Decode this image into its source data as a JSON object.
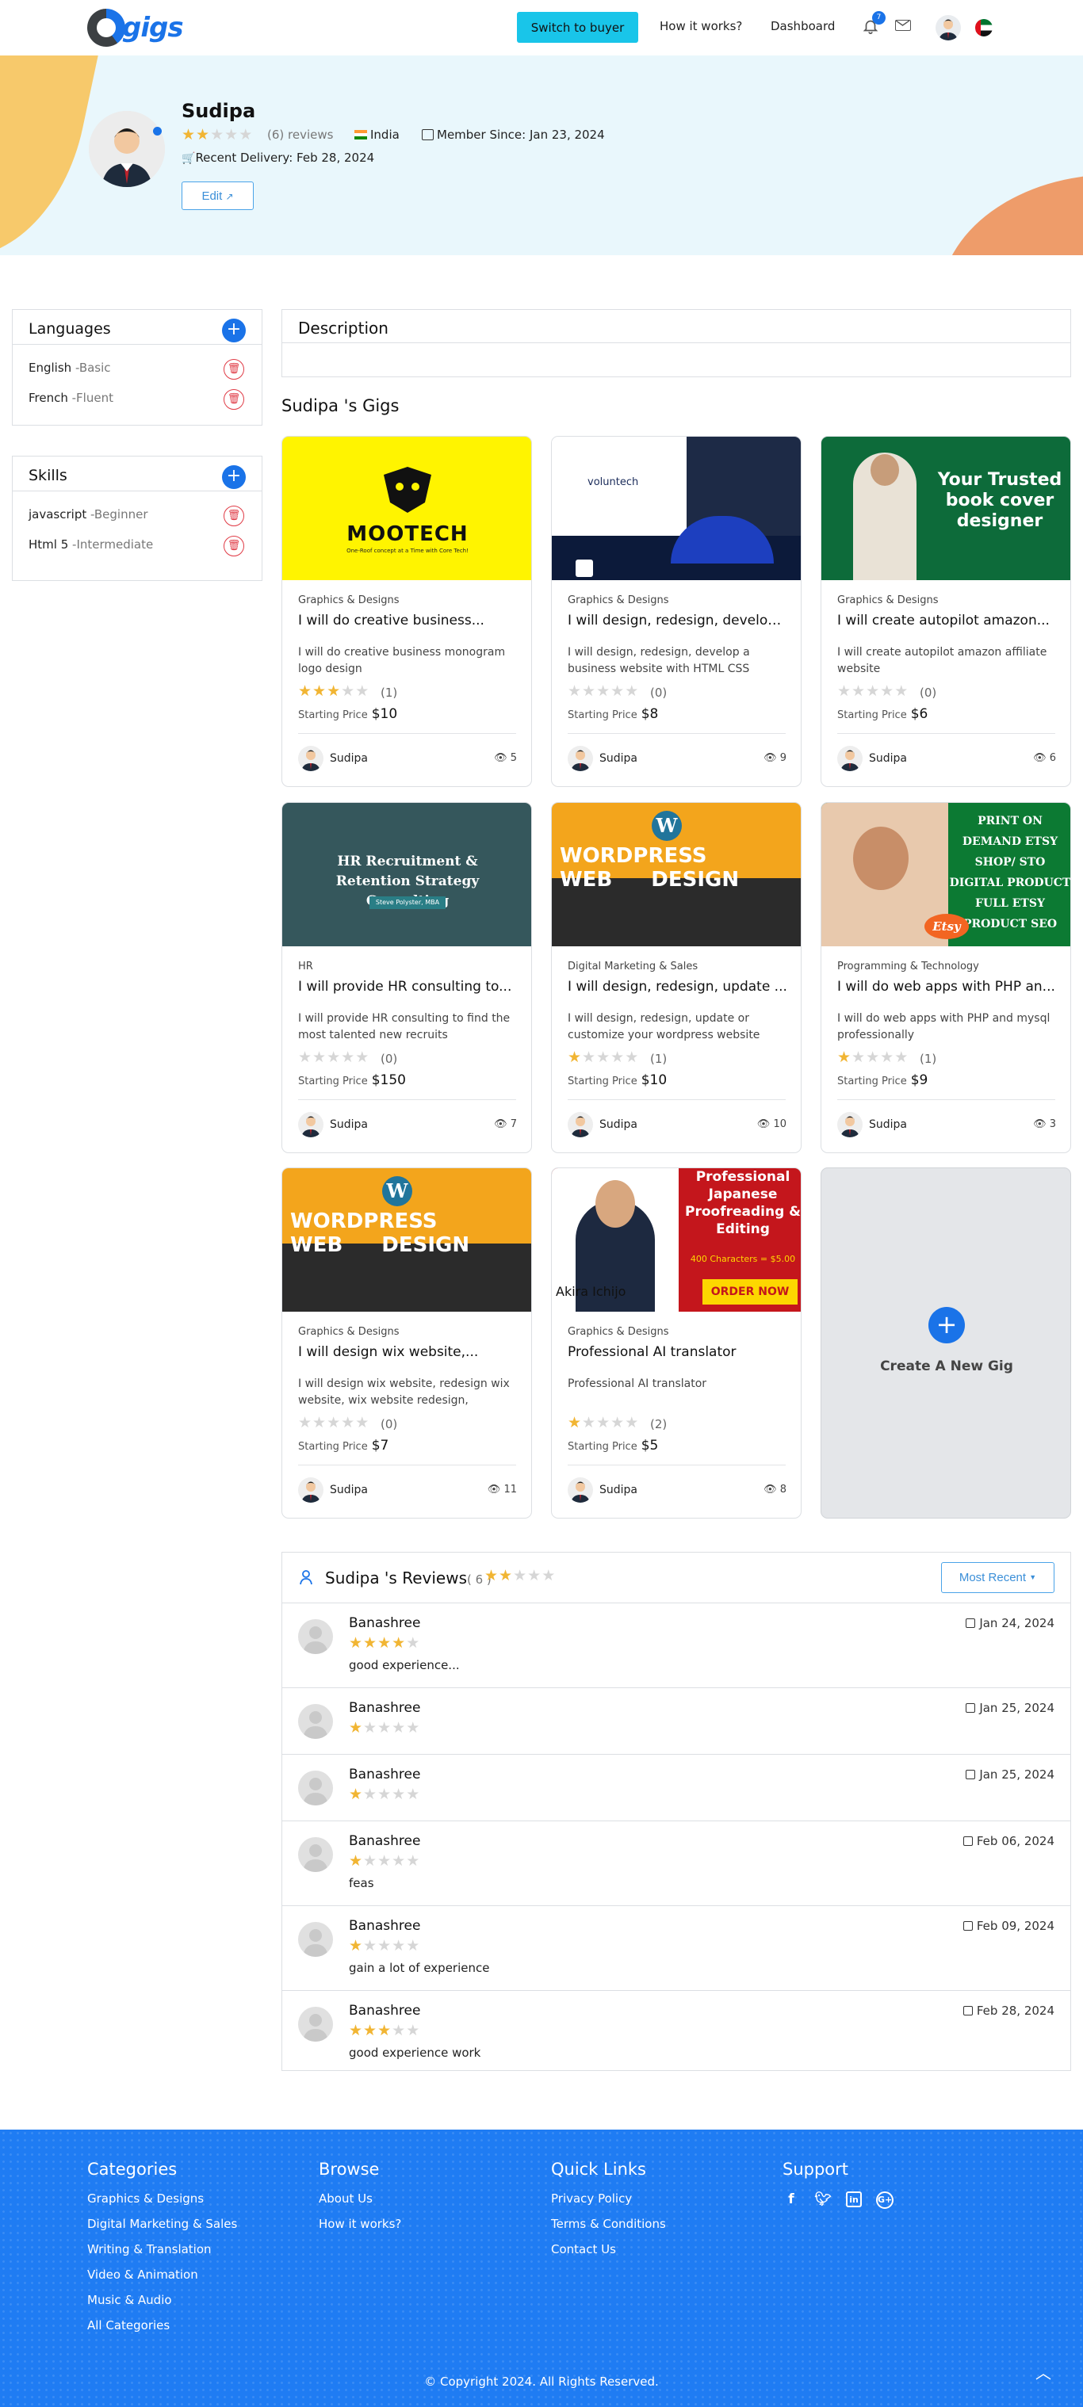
{
  "nav": {
    "logo_text": "gigs",
    "switch_button": "Switch to buyer",
    "how_it_works": "How it works?",
    "dashboard": "Dashboard",
    "notification_count": "7"
  },
  "profile": {
    "name": "Sudipa",
    "rating": 2,
    "reviews_text": "(6) reviews",
    "country": "India",
    "member_since": "Member Since: Jan 23, 2024",
    "recent_delivery": "Recent Delivery: Feb 28, 2024",
    "edit_button": "Edit"
  },
  "languages": {
    "title": "Languages",
    "items": [
      {
        "name": "English",
        "level": " -Basic"
      },
      {
        "name": "French",
        "level": " -Fluent"
      }
    ]
  },
  "skills": {
    "title": "Skills",
    "items": [
      {
        "name": "javascript",
        "level": " -Beginner"
      },
      {
        "name": "Html 5",
        "level": " -Intermediate"
      }
    ]
  },
  "description": {
    "title": "Description"
  },
  "gigs_title": "Sudipa 's Gigs",
  "gigs": [
    {
      "category": "Graphics & Designs",
      "title": "I will do creative business...",
      "desc": "I will do creative business monogram logo design",
      "rating": 3,
      "count": "(1)",
      "price_label": "Starting Price",
      "price": "$10",
      "seller": "Sudipa",
      "views": "5",
      "image_text": "MOOTECH",
      "image_sub": "One-Roof concept at a Time with Core Tech!"
    },
    {
      "category": "Graphics & Designs",
      "title": "I will design, redesign, develop ...",
      "desc": "I will design, redesign, develop a business website with HTML CSS",
      "rating": 0,
      "count": "(0)",
      "price_label": "Starting Price",
      "price": "$8",
      "seller": "Sudipa",
      "views": "9",
      "image_text": "voluntech"
    },
    {
      "category": "Graphics & Designs",
      "title": "I will create autopilot amazon...",
      "desc": "I will create autopilot amazon affiliate website",
      "rating": 0,
      "count": "(0)",
      "price_label": "Starting Price",
      "price": "$6",
      "seller": "Sudipa",
      "views": "6",
      "image_text": "Your Trusted book cover designer"
    },
    {
      "category": "HR",
      "title": "I will provide HR consulting to...",
      "desc": "I will provide HR consulting to find the most talented new recruits",
      "rating": 0,
      "count": "(0)",
      "price_label": "Starting Price",
      "price": "$150",
      "seller": "Sudipa",
      "views": "7",
      "image_text": "HR Recruitment & Retention Strategy Consulting",
      "image_sub": "Steve Polyster, MBA"
    },
    {
      "category": "Digital Marketing & Sales",
      "title": "I will design, redesign, update ...",
      "desc": "I will design, redesign, update or customize your wordpress website",
      "rating": 1,
      "count": "(1)",
      "price_label": "Starting Price",
      "price": "$10",
      "seller": "Sudipa",
      "views": "10",
      "image_text": "WORDPRESS WEB DESIGN"
    },
    {
      "category": "Programming & Technology",
      "title": "I will do web apps with PHP an...",
      "desc": "I will do web apps with PHP and mysql professionally",
      "rating": 1,
      "count": "(1)",
      "price_label": "Starting Price",
      "price": "$9",
      "seller": "Sudipa",
      "views": "3",
      "image_text": "PRINT ON DEMAND ETSY SHOP/ STO DIGITAL PRODUCT FULL ETSY PRODUCT SEO",
      "image_sub": "Etsy"
    },
    {
      "category": "Graphics & Designs",
      "title": "I will design wix website,...",
      "desc": "I will design wix website, redesign wix website, wix website redesign,",
      "rating": 0,
      "count": "(0)",
      "price_label": "Starting Price",
      "price": "$7",
      "seller": "Sudipa",
      "views": "11",
      "image_text": "WORDPRESS WEB DESIGN"
    },
    {
      "category": "Graphics & Designs",
      "title": "Professional AI translator",
      "desc": "Professional AI translator",
      "rating": 1,
      "count": "(2)",
      "price_label": "Starting Price",
      "price": "$5",
      "seller": "Sudipa",
      "views": "8",
      "image_text": "Professional Japanese Proofreading & Editing",
      "image_sub": "400 Characters = $5.00",
      "image_name": "Akira Ichijo",
      "image_cta": "ORDER NOW"
    }
  ],
  "new_gig": {
    "label": "Create A New Gig"
  },
  "reviews": {
    "title": "Sudipa 's Reviews",
    "count": "( 6 )",
    "rating": 2,
    "sort_button": "Most Recent",
    "items": [
      {
        "name": "Banashree",
        "rating": 4,
        "text": "good experience...",
        "date": "Jan 24, 2024"
      },
      {
        "name": "Banashree",
        "rating": 1,
        "text": "",
        "date": "Jan 25, 2024"
      },
      {
        "name": "Banashree",
        "rating": 1,
        "text": "",
        "date": "Jan 25, 2024"
      },
      {
        "name": "Banashree",
        "rating": 1,
        "text": "feas",
        "date": "Feb 06, 2024"
      },
      {
        "name": "Banashree",
        "rating": 1,
        "text": "gain a lot of experience",
        "date": "Feb 09, 2024"
      },
      {
        "name": "Banashree",
        "rating": 3,
        "text": "good experience work",
        "date": "Feb 28, 2024"
      }
    ]
  },
  "footer": {
    "categories": {
      "title": "Categories",
      "links": [
        "Graphics & Designs",
        "Digital Marketing & Sales",
        "Writing & Translation",
        "Video & Animation",
        "Music & Audio",
        "All Categories"
      ]
    },
    "browse": {
      "title": "Browse",
      "links": [
        "About Us",
        "How it works?"
      ]
    },
    "quick_links": {
      "title": "Quick Links",
      "links": [
        "Privacy Policy",
        "Terms & Conditions",
        "Contact Us"
      ]
    },
    "support": {
      "title": "Support",
      "socials": [
        "facebook-icon",
        "twitter-icon",
        "linkedin-icon",
        "google-plus-icon"
      ]
    },
    "copyright": "© Copyright 2024. All Rights Reserved."
  },
  "colors": {
    "accent": "#1a73e8",
    "star": "#f1b533",
    "switch_button": "#19c5e9",
    "footer": "#1f7cf3",
    "danger": "#e03b46"
  }
}
